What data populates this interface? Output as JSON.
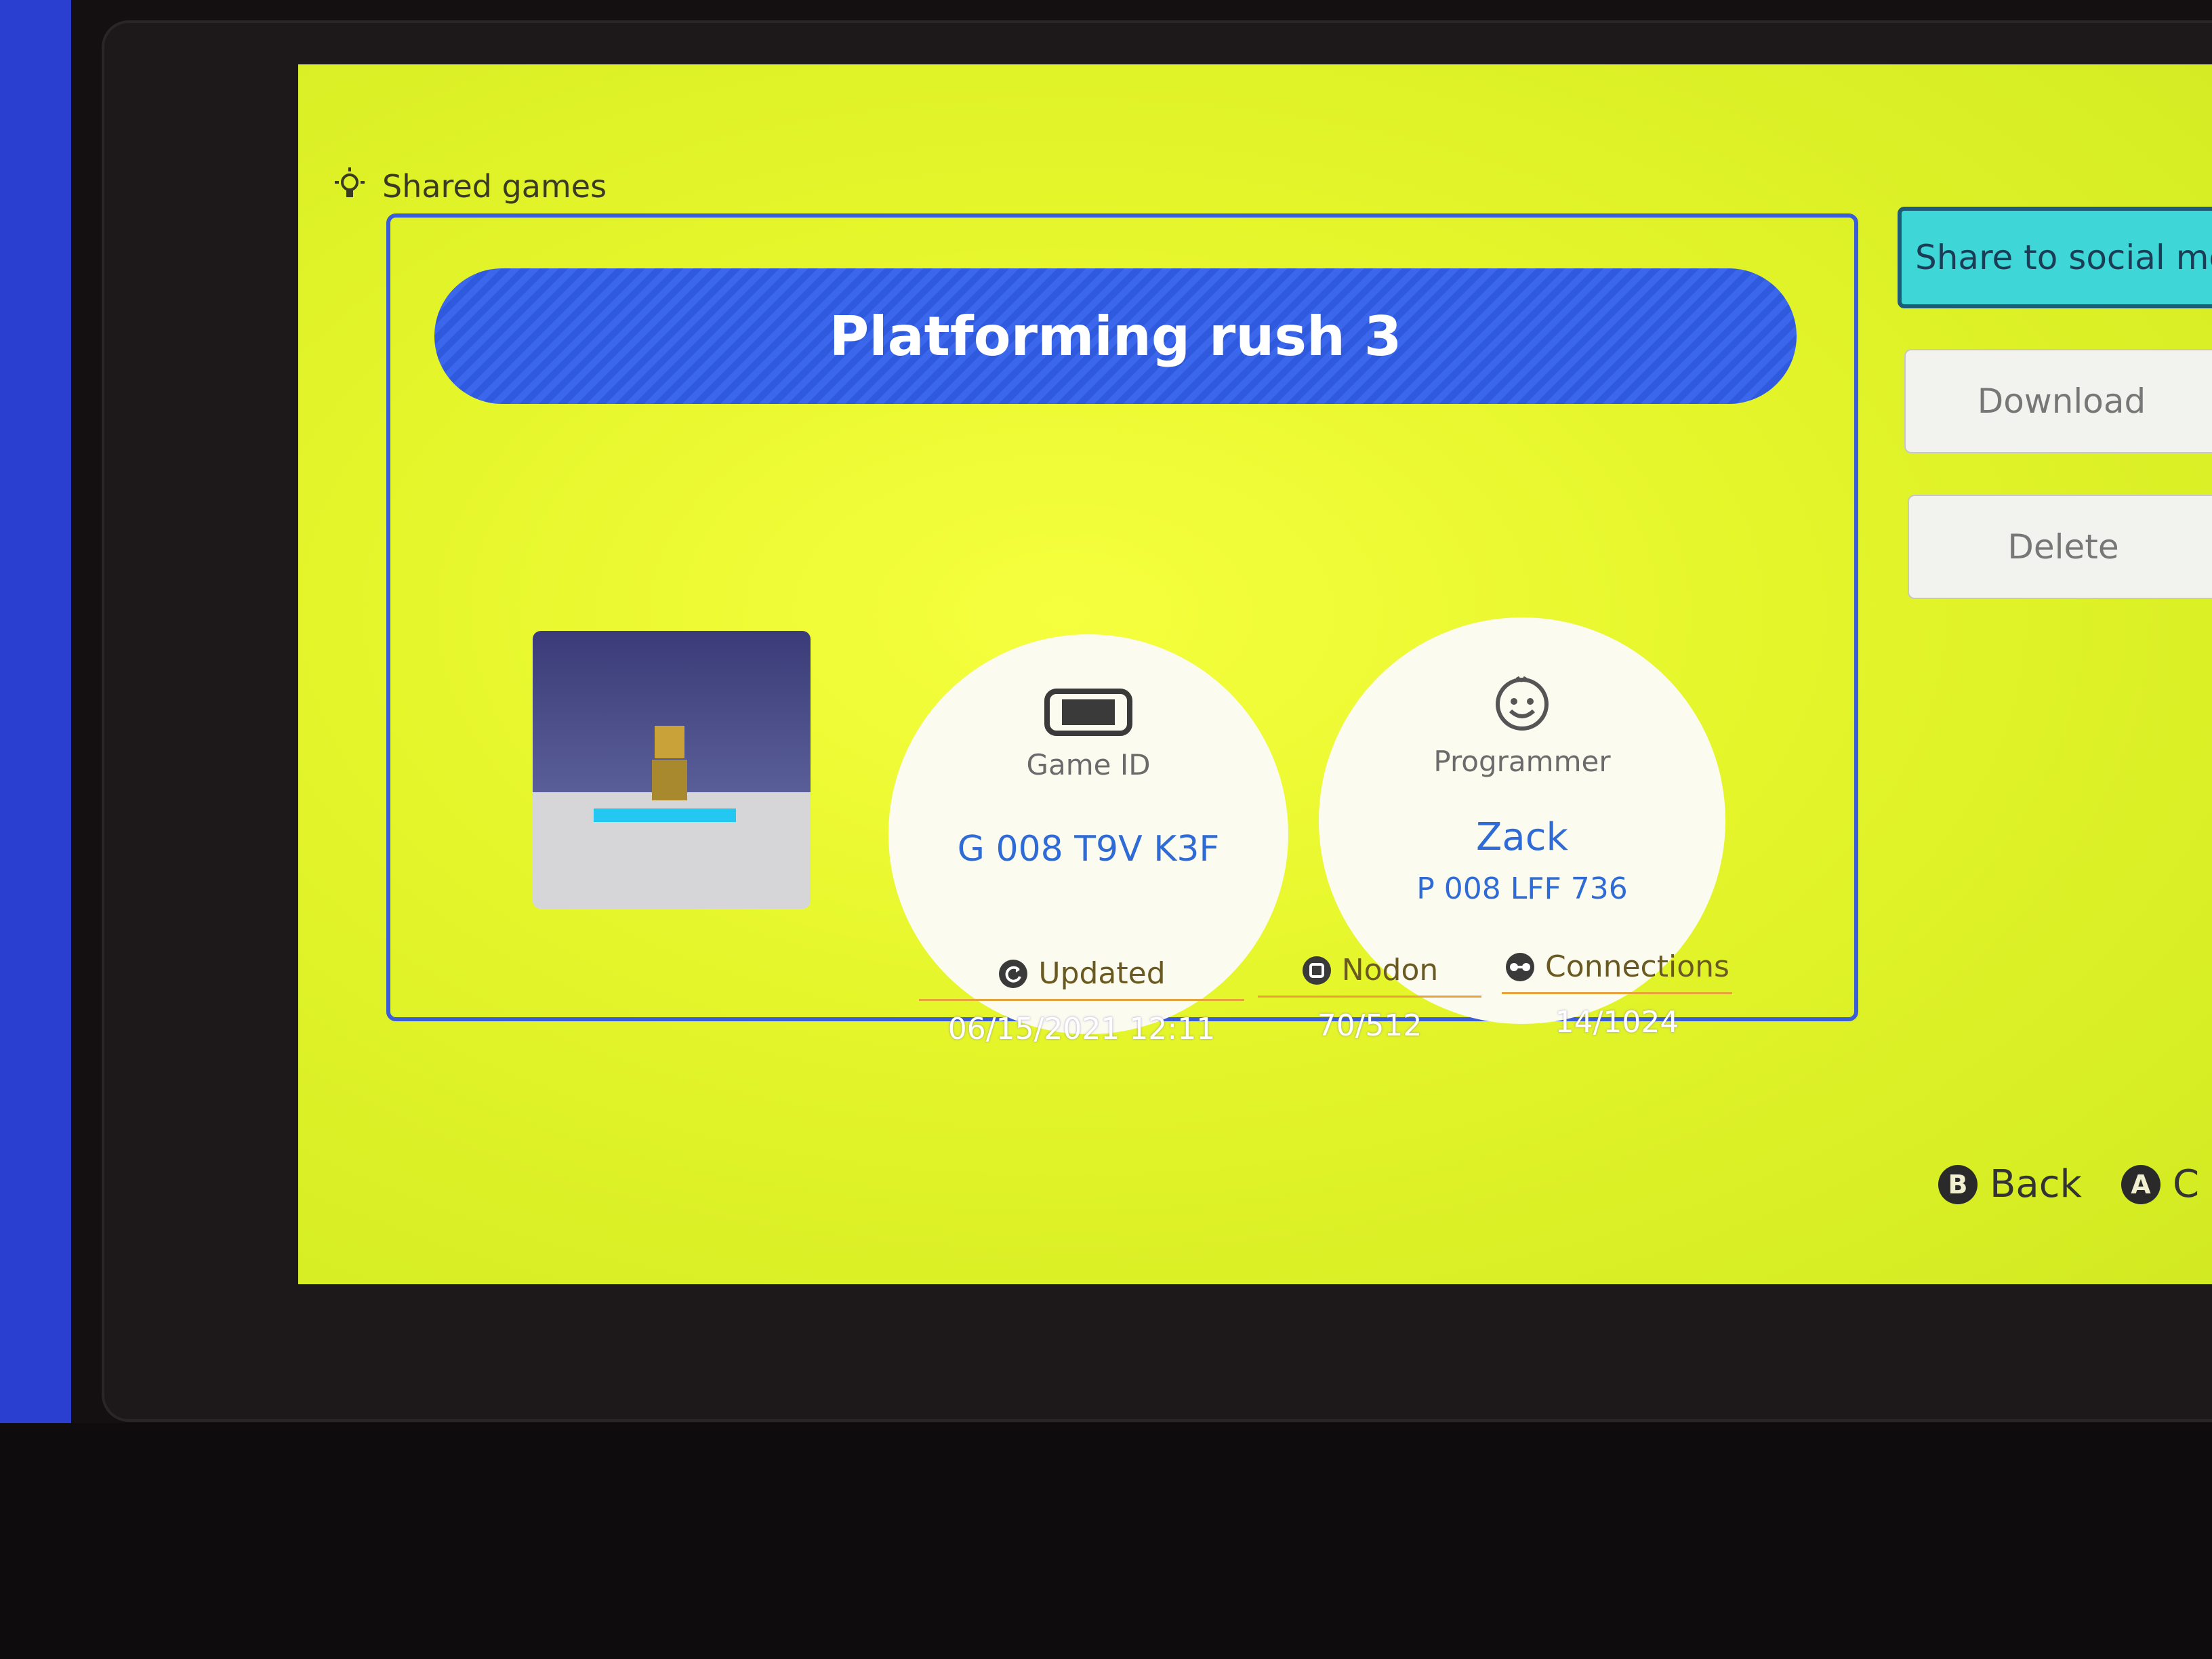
{
  "header": {
    "title": "Shared games",
    "icon": "lightbulb-icon"
  },
  "game": {
    "title": "Platforming rush 3",
    "game_id_label": "Game ID",
    "game_id": "G 008 T9V K3F",
    "programmer_label": "Programmer",
    "programmer_name": "Zack",
    "programmer_id": "P 008 LFF 736"
  },
  "stats": {
    "updated_label": "Updated",
    "updated_value": "06/15/2021 12:11",
    "nodon_label": "Nodon",
    "nodon_value": "70/512",
    "connections_label": "Connections",
    "connections_value": "14/1024"
  },
  "actions": {
    "share_label": "Share to social me",
    "download_label": "Download",
    "delete_label": "Delete"
  },
  "footer": {
    "back_key": "B",
    "back_label": "Back",
    "a_key": "A",
    "a_label": "C"
  },
  "colors": {
    "screen_bg": "#e4f52a",
    "banner": "#3a67ec",
    "accent_text": "#2f6bd6",
    "share_button": "#3fd6d8"
  }
}
